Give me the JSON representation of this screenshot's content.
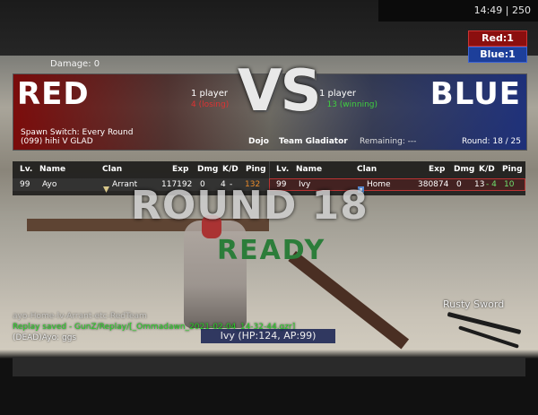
{
  "top_stats": "14:49 | 250",
  "team_scores": {
    "red": "Red:1",
    "blue": "Blue:1"
  },
  "damage": "Damage: 0",
  "header": {
    "red_title": "RED",
    "blue_title": "BLUE",
    "vs": "VS",
    "red_count": "1 player",
    "red_status": "4 (losing)",
    "blue_count": "1 player",
    "blue_status": "13 (winning)",
    "spawn_line1": "Spawn Switch: Every Round",
    "spawn_line2": "(099) hihi V GLAD",
    "map": "Dojo",
    "mode": "Team Gladiator",
    "remaining": "Remaining: ---",
    "round": "Round: 18 / 25"
  },
  "roster": {
    "headers": [
      "Lv.",
      "Name",
      "Clan",
      "Exp",
      "Dmg",
      "K/D",
      "Ping"
    ],
    "red_player": {
      "lv": "99",
      "name": "Ayo",
      "clan": "Arrant",
      "exp": "117192",
      "dmg": "0",
      "k": "4",
      "d": "-",
      "ping": "132"
    },
    "blue_player": {
      "lv": "99",
      "name": "Ivy",
      "clan": "Home",
      "exp": "380874",
      "dmg": "0",
      "k": "13",
      "d": "- 4",
      "ping": "10"
    }
  },
  "round_banner": "ROUND 18",
  "ready_banner": "READY",
  "weapon": "Rusty Sword",
  "chat": [
    {
      "text": "ayo-Home-lv-Arrant-etc-RedTeam",
      "style": "faded"
    },
    {
      "text": "Replay saved - GunZ/Replay/[_Ommadawn_2021-02-04_14-32-44.gzr]",
      "style": "green"
    },
    {
      "text": "(DEAD)Ayo: ggs",
      "style": "normal"
    }
  ],
  "spectate": "Ivy (HP:124, AP:99)",
  "colors": {
    "red_accent": "#8b0f0f",
    "blue_accent": "#1d3f9a",
    "winning": "#3fcf3f",
    "losing": "#dd3333"
  }
}
